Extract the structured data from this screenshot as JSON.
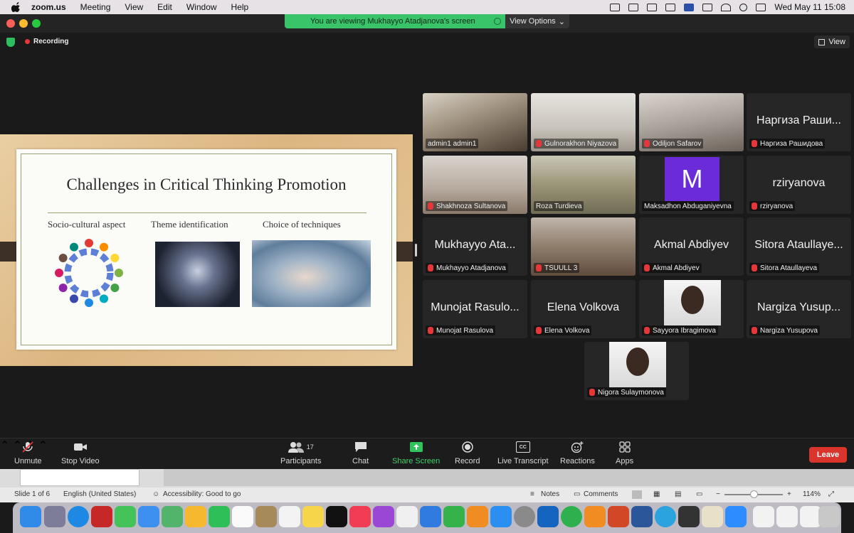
{
  "menubar": {
    "app_name": "zoom.us",
    "items": [
      "Meeting",
      "View",
      "Edit",
      "Window",
      "Help"
    ],
    "clock": "Wed May 11  15:08"
  },
  "banner": {
    "text": "You are viewing Mukhayyo Atadjanova's screen",
    "view_options": "View Options"
  },
  "meeting": {
    "recording_label": "Recording",
    "view_label": "View"
  },
  "slide": {
    "title": "Challenges in Critical Thinking Promotion",
    "subtitles": [
      "Socio-cultural aspect",
      "Theme identification",
      "Choice of techniques"
    ]
  },
  "participants": [
    {
      "label": "admin1 admin1",
      "big": "",
      "muted": false,
      "kind": "video"
    },
    {
      "label": "Gulnorakhon Niyazova",
      "big": "",
      "muted": true,
      "kind": "video"
    },
    {
      "label": "Odiljon Safarov",
      "big": "",
      "muted": true,
      "kind": "video"
    },
    {
      "label": "Наргиза Рашидова",
      "big": "Наргиза Раши...",
      "muted": true,
      "kind": "name"
    },
    {
      "label": "Shakhnoza Sultanova",
      "big": "",
      "muted": true,
      "kind": "video"
    },
    {
      "label": "Roza Turdieva",
      "big": "",
      "muted": false,
      "kind": "video",
      "active": true
    },
    {
      "label": "Maksadhon Abduganiyevna",
      "big": "M",
      "muted": false,
      "kind": "avatar"
    },
    {
      "label": "rziryanova",
      "big": "rziryanova",
      "muted": true,
      "kind": "name"
    },
    {
      "label": "Mukhayyo Atadjanova",
      "big": "Mukhayyo Ata...",
      "muted": true,
      "kind": "name"
    },
    {
      "label": "TSUULL 3",
      "big": "",
      "muted": true,
      "kind": "video"
    },
    {
      "label": "Akmal Abdiyev",
      "big": "Akmal Abdiyev",
      "muted": true,
      "kind": "name"
    },
    {
      "label": "Sitora Ataullayeva",
      "big": "Sitora Ataullaye...",
      "muted": true,
      "kind": "name"
    },
    {
      "label": "Munojat Rasulova",
      "big": "Munojat Rasulo...",
      "muted": true,
      "kind": "name"
    },
    {
      "label": "Elena Volkova",
      "big": "Elena Volkova",
      "muted": true,
      "kind": "name"
    },
    {
      "label": "Sayyora Ibragimova",
      "big": "",
      "muted": true,
      "kind": "photo"
    },
    {
      "label": "Nargiza Yusupova",
      "big": "Nargiza Yusup...",
      "muted": true,
      "kind": "name"
    },
    {
      "label": "Nigora Sulaymonova",
      "big": "",
      "muted": true,
      "kind": "photo"
    }
  ],
  "toolbar": {
    "unmute": "Unmute",
    "stop_video": "Stop Video",
    "participants": "Participants",
    "participants_count": "17",
    "chat": "Chat",
    "share_screen": "Share Screen",
    "record": "Record",
    "live_transcript": "Live Transcript",
    "reactions": "Reactions",
    "apps": "Apps",
    "leave": "Leave",
    "cc": "CC"
  },
  "status": {
    "slide": "Slide 1 of 6",
    "language": "English (United States)",
    "accessibility": "Accessibility: Good to go",
    "notes": "Notes",
    "comments": "Comments",
    "zoom": "114%"
  },
  "colors": {
    "accent_green": "#37c95b",
    "leave_red": "#d9352d",
    "share_green": "#3ac46a"
  }
}
